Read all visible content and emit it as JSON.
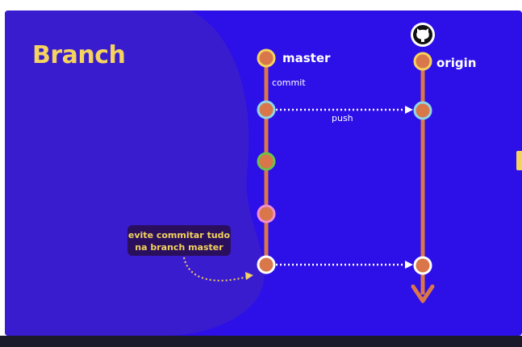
{
  "title": "Branch",
  "branches": {
    "master": "master",
    "origin": "origin"
  },
  "labels": {
    "commit": "commit",
    "push": "push"
  },
  "callout": {
    "line1": "evite commitar tudo",
    "line2": "na branch master"
  },
  "icons": {
    "origin_remote": "github-icon"
  },
  "colors": {
    "background": "#2d0fe8",
    "blob": "#3a1ccf",
    "title": "#f4d35e",
    "branch_line": "#d9764a",
    "commit_core": "#d9764a",
    "ring_head": "#f4d35e",
    "ring_push": "#8fd6e6",
    "ring_green": "#6cc24a",
    "ring_pink": "#f08fd0",
    "ring_white": "#ffffff"
  },
  "master_commits": [
    {
      "ring": "yellow"
    },
    {
      "ring": "cyan"
    },
    {
      "ring": "green"
    },
    {
      "ring": "pink"
    },
    {
      "ring": "white"
    }
  ],
  "origin_commits": [
    {
      "ring": "yellow"
    },
    {
      "ring": "cyan"
    },
    {
      "ring": "white"
    }
  ]
}
